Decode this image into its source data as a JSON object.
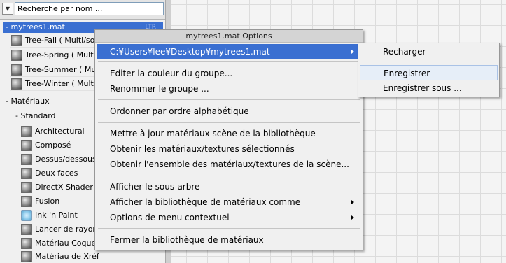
{
  "search": {
    "dropdown_icon": "triangle-down-icon",
    "placeholder": "Recherche par nom ..."
  },
  "library_mytrees": {
    "label": "- mytrees1.mat",
    "badge": "LTR",
    "items": [
      {
        "label": "Tree-Fall  ( Multi/so",
        "thumb": "sphere-thumbnail"
      },
      {
        "label": "Tree-Spring  ( Multi",
        "thumb": "sphere-thumbnail"
      },
      {
        "label": "Tree-Summer  ( Mult",
        "thumb": "sphere-thumbnail"
      },
      {
        "label": "Tree-Winter  ( Multi",
        "thumb": "sphere-thumbnail"
      }
    ]
  },
  "library_materiaux": {
    "label": "- Matériaux",
    "group_label": "- Standard",
    "items": [
      {
        "label": "Architectural",
        "thumb": "sphere-thumbnail"
      },
      {
        "label": "Composé",
        "thumb": "sphere-thumbnail"
      },
      {
        "label": "Dessus/dessous",
        "thumb": "sphere-thumbnail"
      },
      {
        "label": "Deux faces",
        "thumb": "sphere-thumbnail"
      },
      {
        "label": "DirectX Shader",
        "thumb": "sphere-thumbnail"
      },
      {
        "label": "Fusion",
        "thumb": "sphere-thumbnail"
      },
      {
        "label": "Ink 'n Paint",
        "thumb": "ink-paint-thumbnail"
      },
      {
        "label": "Lancer de rayon",
        "thumb": "sphere-thumbnail"
      },
      {
        "label": "Matériau Coque",
        "thumb": "sphere-thumbnail"
      },
      {
        "label": "Matériau de Xréf",
        "thumb": "sphere-thumbnail"
      }
    ]
  },
  "context_menu": {
    "title": "mytrees1.mat Options",
    "items": [
      {
        "label": "C:¥Users¥lee¥Desktop¥mytrees1.mat",
        "submenu": true,
        "highlighted": true
      },
      {
        "label": "Editer la couleur du groupe..."
      },
      {
        "label": "Renommer le groupe ..."
      },
      {
        "label": "Ordonner par ordre alphabétique"
      },
      {
        "label": "Mettre à jour matériaux scène de la bibliothèque"
      },
      {
        "label": "Obtenir les matériaux/textures sélectionnés"
      },
      {
        "label": "Obtenir l'ensemble des matériaux/textures de la scène..."
      },
      {
        "label": "Afficher le sous-arbre"
      },
      {
        "label": "Afficher la bibliothèque de matériaux comme",
        "submenu": true
      },
      {
        "label": "Options de menu contextuel",
        "submenu": true
      },
      {
        "label": "Fermer la bibliothèque de matériaux"
      }
    ]
  },
  "submenu": {
    "items": [
      {
        "label": "Recharger"
      },
      {
        "label": "Enregistrer",
        "hovered": true
      },
      {
        "label": "Enregistrer sous ..."
      }
    ]
  },
  "colors": {
    "selection": "#3a6fd1",
    "hover": "#e6eef8",
    "menu_background": "#f0f0f0"
  }
}
